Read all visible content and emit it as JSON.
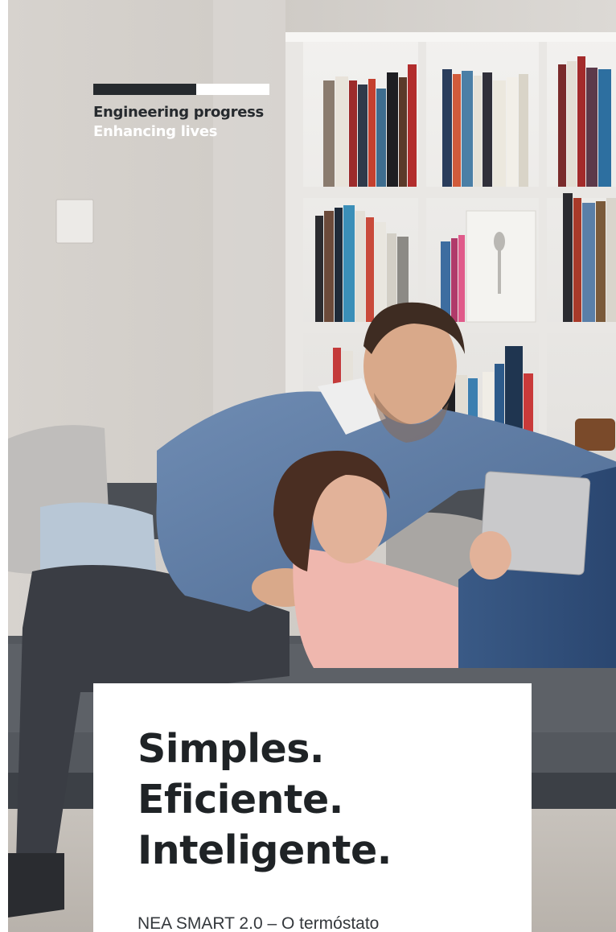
{
  "brand": {
    "line1": "Engineering progress",
    "line2": "Enhancing lives",
    "bar_colors": [
      "#262a2e",
      "#ffffff"
    ]
  },
  "photo": {
    "description_icon": "family-on-sofa-photo"
  },
  "card": {
    "headline": [
      "Simples.",
      "Eficiente.",
      "Inteligente."
    ],
    "subline": "NEA SMART 2.0 – O termóstato"
  },
  "colors": {
    "text_dark": "#1f2326",
    "wall": "#d6d3cf",
    "sofa": "#4b4f55"
  }
}
